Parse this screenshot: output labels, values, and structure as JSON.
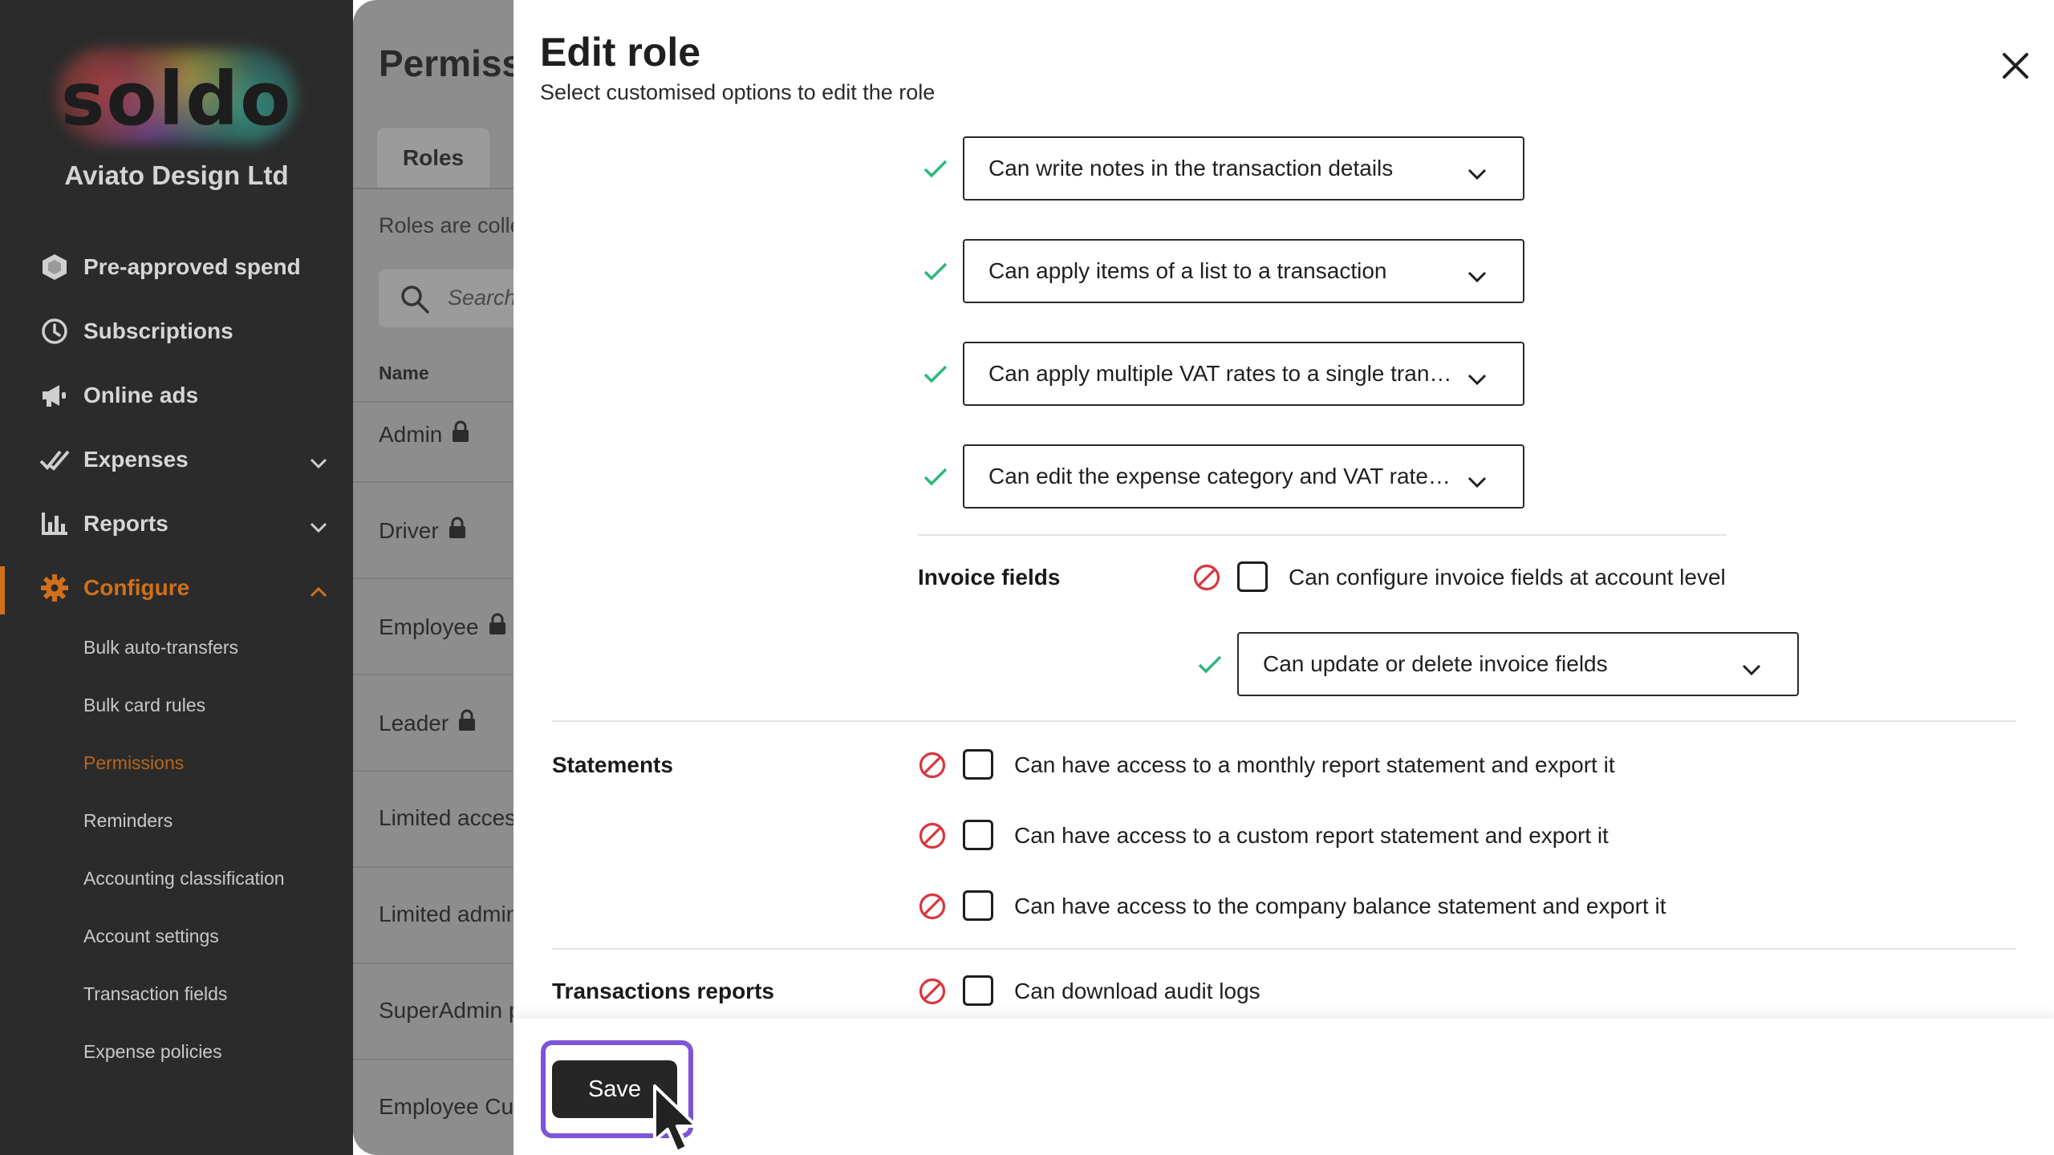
{
  "sidebar": {
    "logo_text": "soldo",
    "company": "Aviato Design Ltd",
    "nav": [
      {
        "label": "Pre-approved spend",
        "icon": "hexagon-icon"
      },
      {
        "label": "Subscriptions",
        "icon": "clock-icon"
      },
      {
        "label": "Online ads",
        "icon": "megaphone-icon"
      },
      {
        "label": "Expenses",
        "icon": "double-check-icon"
      },
      {
        "label": "Reports",
        "icon": "bar-chart-icon"
      },
      {
        "label": "Configure",
        "icon": "gear-icon"
      }
    ],
    "sub_items": [
      "Bulk auto-transfers",
      "Bulk card rules",
      "Permissions",
      "Reminders",
      "Accounting classification",
      "Account settings",
      "Transaction fields",
      "Expense policies"
    ]
  },
  "page": {
    "title": "Permissions",
    "tab_roles": "Roles",
    "description": "Roles are collections of permissions",
    "search_placeholder": "Search",
    "col_name": "Name",
    "rows": [
      "Admin",
      "Driver",
      "Employee",
      "Leader",
      "Limited access",
      "Limited admin",
      "SuperAdmin p",
      "Employee Custom"
    ]
  },
  "modal": {
    "title": "Edit role",
    "subtitle": "Select customised options to edit the role",
    "selects_top": [
      "Can write notes in the transaction details",
      "Can apply items of a list to a transaction",
      "Can apply multiple VAT rates to a single trans...",
      "Can edit the expense category and VAT rate f..."
    ],
    "invoice_fields": {
      "label": "Invoice fields",
      "checkbox": "Can configure invoice fields at account level",
      "select": "Can update or delete invoice fields"
    },
    "statements": {
      "label": "Statements",
      "items": [
        "Can have access to a monthly report statement and export it",
        "Can have access to a custom report statement and export it",
        "Can have access to the company balance statement and export it"
      ]
    },
    "transactions_reports": {
      "label": "Transactions reports",
      "items": [
        "Can download audit logs"
      ]
    },
    "save_label": "Save"
  },
  "colors": {
    "accent_orange": "#d0701a",
    "check_green": "#2db87d",
    "block_red": "#d9363e",
    "focus_purple": "#7d55d8"
  }
}
